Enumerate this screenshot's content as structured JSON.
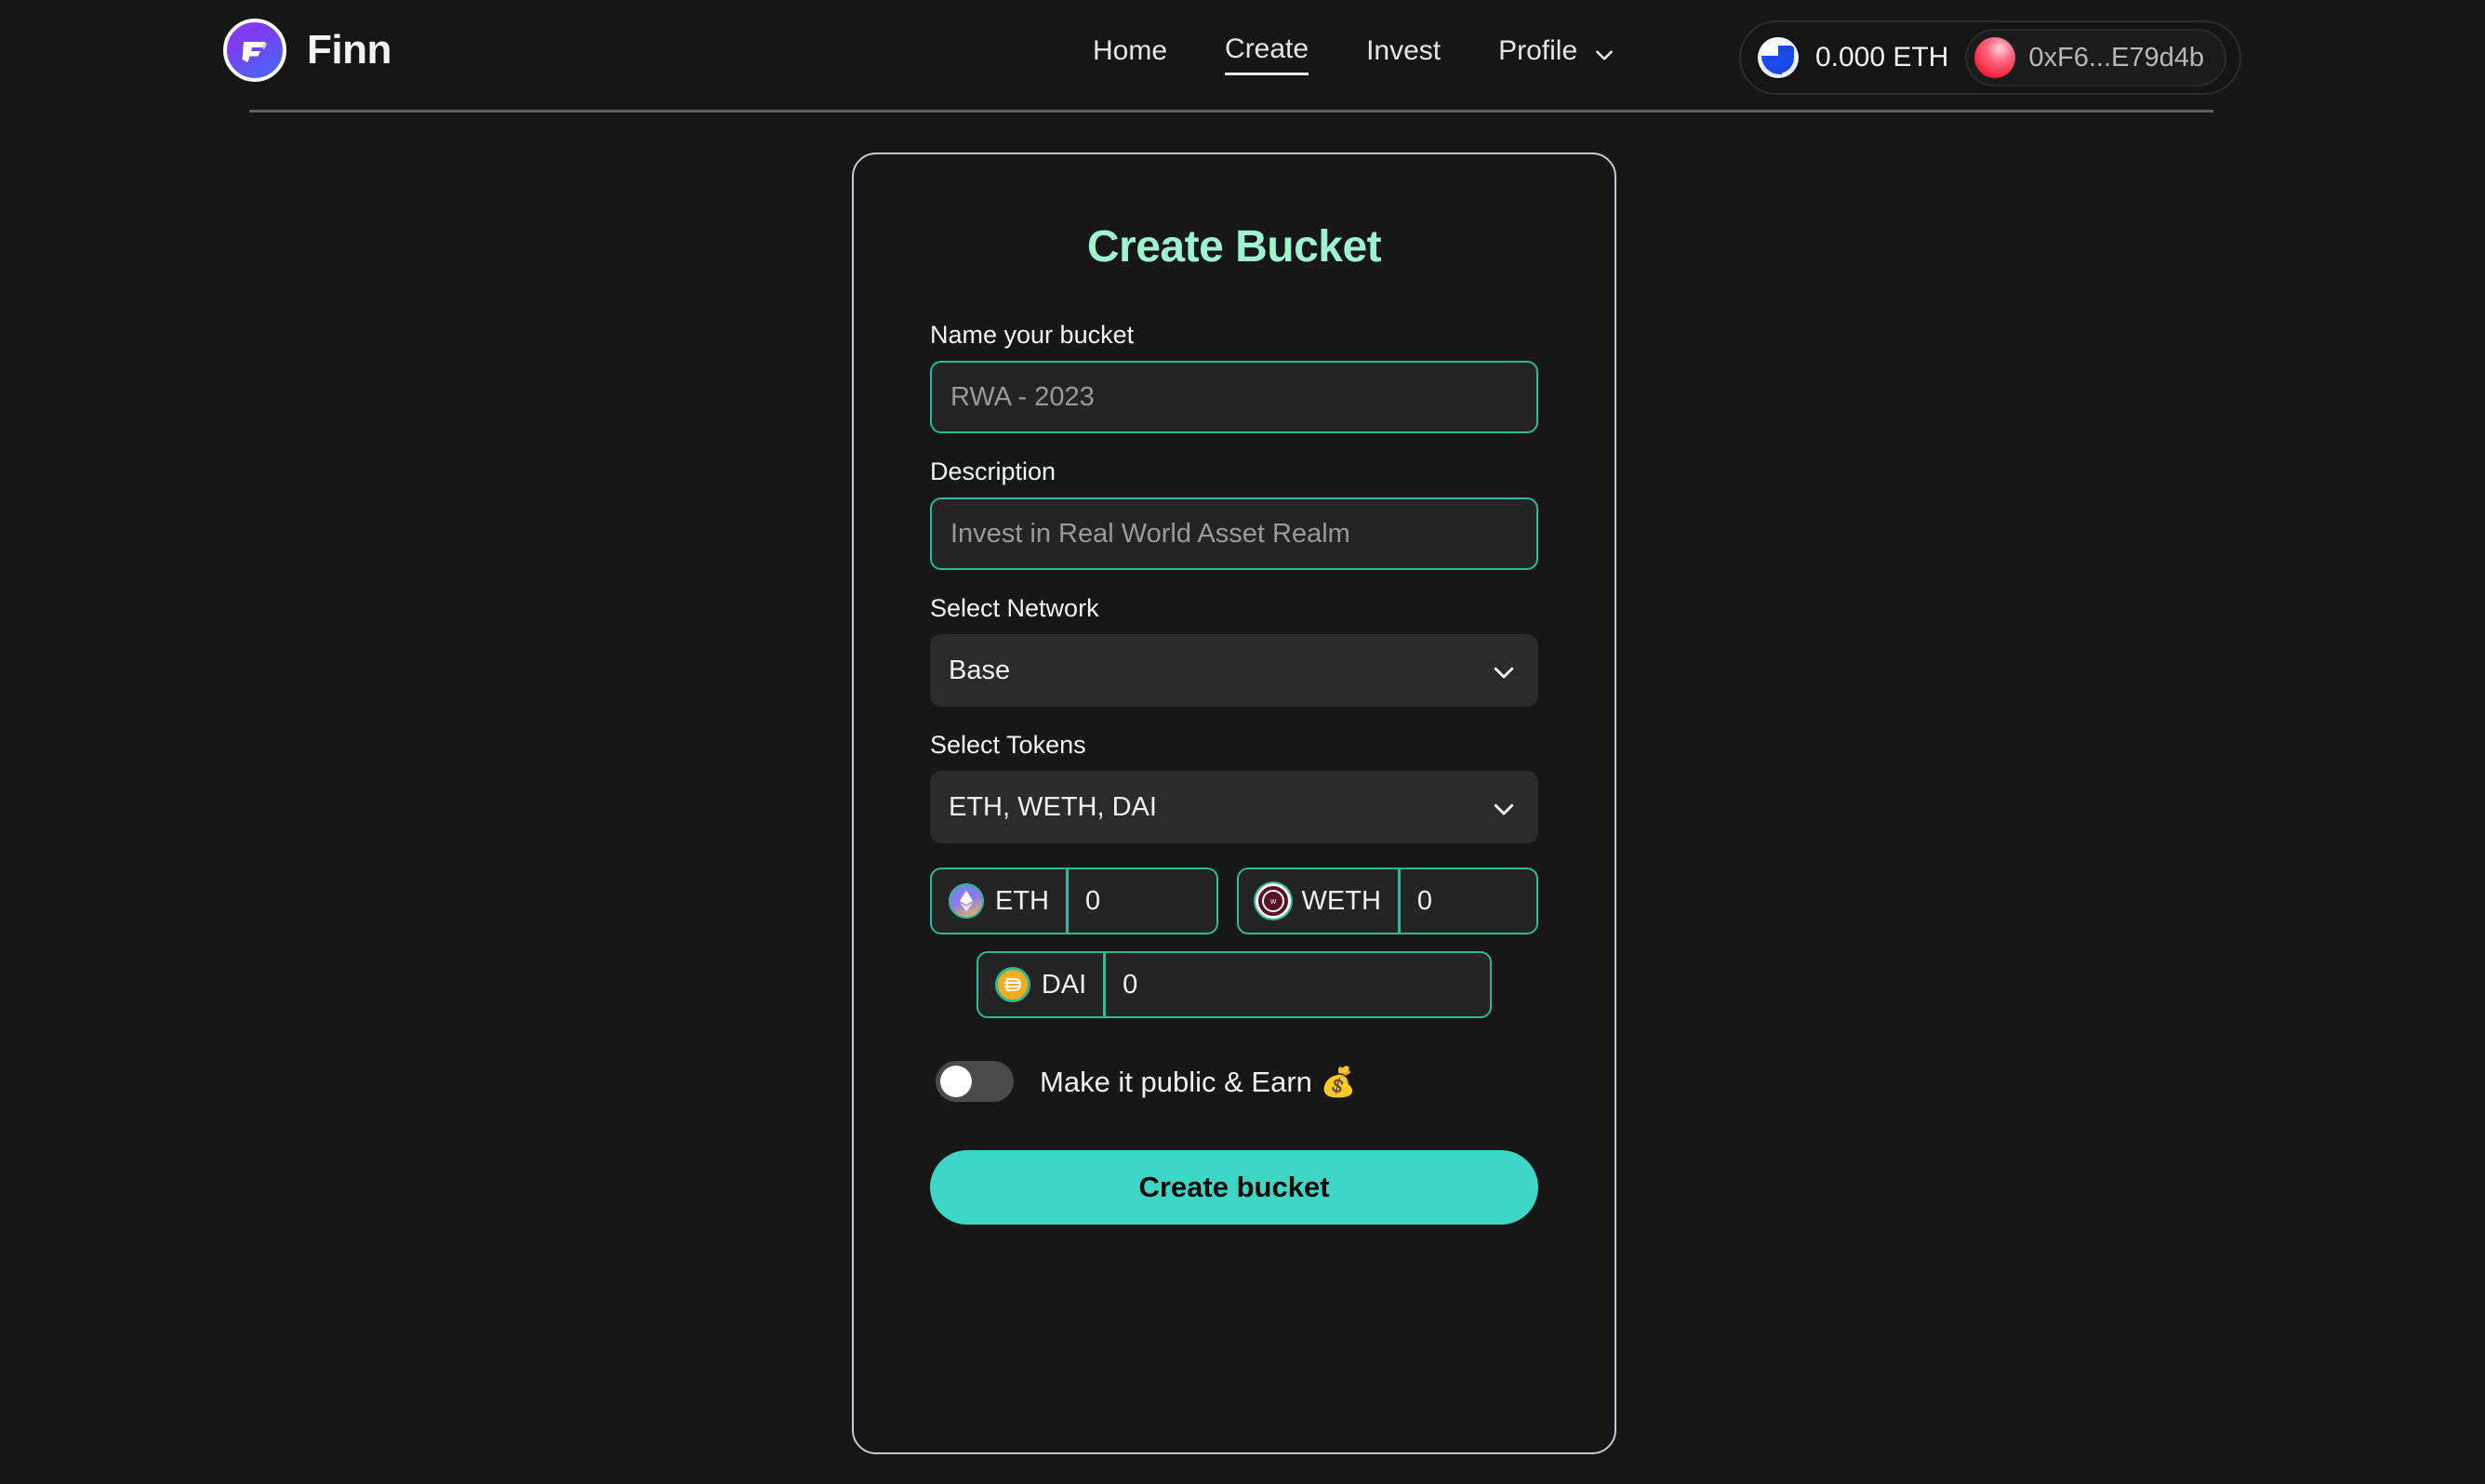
{
  "brand": {
    "name": "Finn",
    "logo_icon": "finn-f-logo-icon"
  },
  "nav": {
    "items": [
      {
        "label": "Home",
        "active": false
      },
      {
        "label": "Create",
        "active": true
      },
      {
        "label": "Invest",
        "active": false
      },
      {
        "label": "Profile",
        "active": false
      }
    ],
    "profile_chevron_icon": "chevron-down-icon"
  },
  "wallet": {
    "network_icon": "base-network-icon",
    "balance": "0.000 ETH",
    "avatar_icon": "wallet-avatar-icon",
    "address": "0xF6...E79d4b"
  },
  "card": {
    "title": "Create Bucket",
    "name_field": {
      "label": "Name your bucket",
      "value": "",
      "placeholder": "RWA - 2023"
    },
    "description_field": {
      "label": "Description",
      "value": "",
      "placeholder": "Invest in Real World Asset Realm"
    },
    "network_select": {
      "label": "Select Network",
      "value": "Base",
      "chevron_icon": "chevron-down-icon"
    },
    "tokens_select": {
      "label": "Select Tokens",
      "value": "ETH, WETH, DAI",
      "chevron_icon": "chevron-down-icon"
    },
    "token_rows": [
      [
        {
          "symbol": "ETH",
          "icon": "eth-coin-icon",
          "amount": "0"
        },
        {
          "symbol": "WETH",
          "icon": "weth-coin-icon",
          "amount": "0"
        }
      ],
      [
        {
          "symbol": "DAI",
          "icon": "dai-coin-icon",
          "amount": "0"
        }
      ]
    ],
    "public_toggle": {
      "label": "Make it public & Earn 💰",
      "state": "off"
    },
    "submit_label": "Create bucket"
  },
  "colors": {
    "page_background": "#161616",
    "accent_mint": "#9df3d2",
    "accent_teal": "#3ed6c4",
    "input_border": "#2fb99a",
    "card_border": "#c6c9d2"
  }
}
